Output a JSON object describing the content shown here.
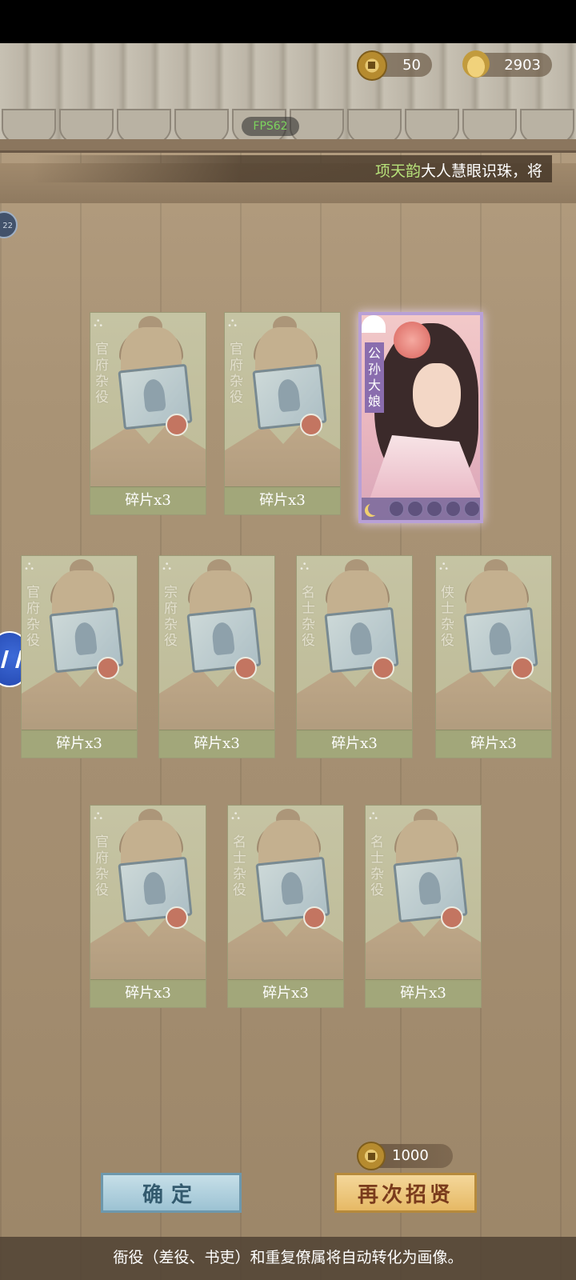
{
  "currency": {
    "coins": "50",
    "ingots": "2903"
  },
  "fps": "FPS62",
  "marquee": {
    "name": "项天韵",
    "text": "大人慧眼识珠，将"
  },
  "side_badge": "22",
  "cards": [
    {
      "label": "官府杂役",
      "footer": "碎片x3"
    },
    {
      "label": "官府杂役",
      "footer": "碎片x3"
    },
    {
      "label": "官府杂役",
      "footer": "碎片x3"
    },
    {
      "label": "宗府杂役",
      "footer": "碎片x3"
    },
    {
      "label": "名士杂役",
      "footer": "碎片x3"
    },
    {
      "label": "侠士杂役",
      "footer": "碎片x3"
    },
    {
      "label": "官府杂役",
      "footer": "碎片x3"
    },
    {
      "label": "名士杂役",
      "footer": "碎片x3"
    },
    {
      "label": "名士杂役",
      "footer": "碎片x3"
    }
  ],
  "hero": {
    "name": "公孙大娘",
    "stars_total": 5,
    "stars_filled": 0
  },
  "recruit_cost": "1000",
  "buttons": {
    "confirm": "确定",
    "recruit_again": "再次招贤"
  },
  "notice": "衙役（差役、书吏）和重复僚属将自动转化为画像。",
  "colors": {
    "accent_name": "#b7e27a",
    "fps": "#7cd35e",
    "hero_frame": "#b8a0d6"
  }
}
